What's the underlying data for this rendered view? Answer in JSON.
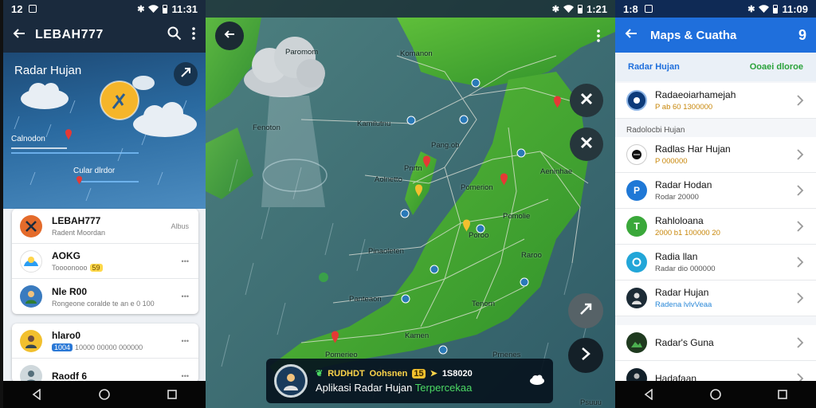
{
  "screen1": {
    "status": {
      "time": "12",
      "clock": "11:31"
    },
    "header": {
      "title": "LEBAH777"
    },
    "hero": {
      "title": "Radar Hujan",
      "location_label": "Calnodon",
      "overlay_label": "Cular dlrdor"
    },
    "card1": [
      {
        "name": "LEBAH777",
        "sub": "Radent Moordan",
        "meta": "Albus"
      },
      {
        "name": "AOKG",
        "sub": "Toooonooo",
        "tag": "59"
      },
      {
        "name": "Nle R00",
        "sub": "Rongeone coralde te an e 0 100"
      }
    ],
    "card2": [
      {
        "name": "hlaro0",
        "badge": "1004",
        "sub": "10000 00000 000000"
      },
      {
        "name": "Raodf 6",
        "sub": ""
      }
    ]
  },
  "screen2": {
    "status": {
      "clock": "1:21"
    },
    "labels": [
      "Komanon",
      "Kamilutnu",
      "Pang.ob",
      "Pnrtn",
      "Aolnetto",
      "Pomolie",
      "Pinaoleten",
      "Raroo",
      "Panteaon",
      "Tenorn",
      "Kamen",
      "Fenoton",
      "Paromom",
      "Pomerion",
      "Aeninhae",
      "Prnenes",
      "Poroo",
      "Pomerieo",
      "Psuuu"
    ],
    "popup": {
      "line1_a": "RUDHDT",
      "line1_b": "Oohsnen",
      "line1_c": "15",
      "line1_d": "1S8020",
      "line2": "Aplikasi Radar Hujan",
      "line2_green": "Terpercekaa"
    }
  },
  "screen3": {
    "status": {
      "time": "1:8",
      "clock": "11:09"
    },
    "header": {
      "title": "Maps & Cuatha",
      "badge": "9"
    },
    "tabs": {
      "left": "Radar Hujan",
      "right": "Ooaei dloroe"
    },
    "section_label": "Radolocbi Hujan",
    "group1": [
      {
        "title": "Radaeoiarhamejah",
        "sub": "P ab 60 1300000",
        "sub_color": "#c8870a"
      }
    ],
    "group2": [
      {
        "title": "Radlas Har Hujan",
        "sub": "P 000000",
        "sub_color": "#c8870a"
      },
      {
        "title": "Radar Hodan",
        "sub": "Rodar 20000",
        "sub_color": "#555555"
      },
      {
        "title": "Rahloloana",
        "sub": "2000 b1 100000 20",
        "sub_color": "#c8870a"
      },
      {
        "title": "Radia llan",
        "sub": "Radar dio 000000",
        "sub_color": "#555555"
      },
      {
        "title": "Radar Hujan",
        "sub": "Radena lvlvVeaa",
        "sub_color": "#2a88d8"
      }
    ],
    "group3": [
      {
        "title": "Radar's Guna",
        "sub": "",
        "sub_color": "#555555"
      },
      {
        "title": "Hadafaan",
        "sub": "",
        "sub_color": "#555555"
      }
    ]
  },
  "colors": {
    "accent_blue": "#1f6fdc",
    "tab_green": "#2aa23a",
    "tag_yellow": "#ffd84a",
    "dark_header": "#1a2a3d"
  }
}
